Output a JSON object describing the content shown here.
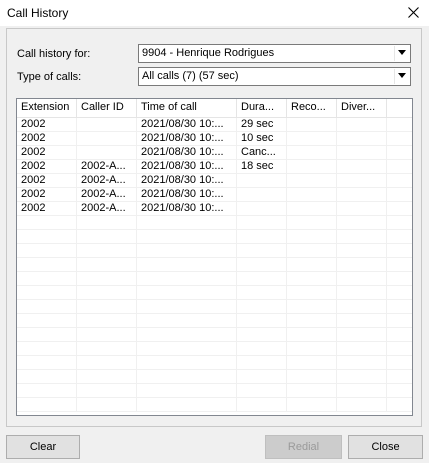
{
  "window": {
    "title": "Call History"
  },
  "filters": {
    "call_history_label": "Call history for:",
    "call_history_value": "9904 - Henrique Rodrigues",
    "type_label": "Type of calls:",
    "type_value": "All calls (7) (57 sec)"
  },
  "table": {
    "columns": [
      "Extension",
      "Caller ID",
      "Time of call",
      "Dura...",
      "Reco...",
      "Diver..."
    ],
    "rows": [
      [
        "2002",
        "",
        "2021/08/30 10:...",
        "29 sec",
        "",
        ""
      ],
      [
        "2002",
        "",
        "2021/08/30 10:...",
        "10 sec",
        "",
        ""
      ],
      [
        "2002",
        "",
        "2021/08/30 10:...",
        "Canc...",
        "",
        ""
      ],
      [
        "2002",
        "2002-A...",
        "2021/08/30 10:...",
        "18 sec",
        "",
        ""
      ],
      [
        "2002",
        "2002-A...",
        "2021/08/30 10:...",
        "",
        "",
        ""
      ],
      [
        "2002",
        "2002-A...",
        "2021/08/30 10:...",
        "",
        "",
        ""
      ],
      [
        "2002",
        "2002-A...",
        "2021/08/30 10:...",
        "",
        "",
        ""
      ]
    ]
  },
  "buttons": {
    "clear": "Clear",
    "redial": "Redial",
    "close": "Close"
  }
}
